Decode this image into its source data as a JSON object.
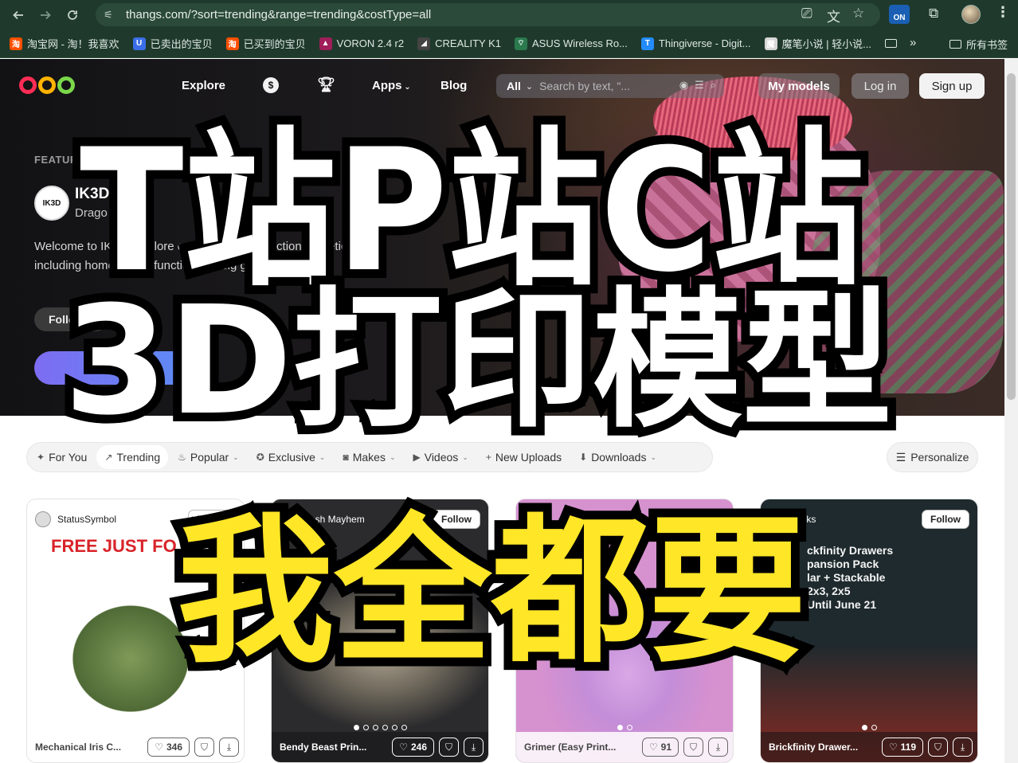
{
  "browser": {
    "url": "thangs.com/?sort=trending&range=trending&costType=all",
    "extension_badge": "ON",
    "bookmarks": [
      {
        "label": "淘宝网 - 淘！我喜欢",
        "icon": "taobao-icon",
        "color": "#ff5000",
        "glyph": "淘"
      },
      {
        "label": "已卖出的宝贝",
        "icon": "shield-icon",
        "color": "#3b6ee8",
        "glyph": "U"
      },
      {
        "label": "已买到的宝贝",
        "icon": "taobao-icon",
        "color": "#ff5000",
        "glyph": "淘"
      },
      {
        "label": "VORON 2.4 r2",
        "icon": "voron-icon",
        "color": "#a01e5a",
        "glyph": "▲"
      },
      {
        "label": "CREALITY K1",
        "icon": "creality-icon",
        "color": "#444444",
        "glyph": "◢"
      },
      {
        "label": "ASUS Wireless Ro...",
        "icon": "wifi-icon",
        "color": "#2a7a4e",
        "glyph": "⌔"
      },
      {
        "label": "Thingiverse - Digit...",
        "icon": "thingiverse-icon",
        "color": "#248bfb",
        "glyph": "T"
      },
      {
        "label": "魔笔小说 | 轻小说...",
        "icon": "book-icon",
        "color": "#d8d8d8",
        "glyph": "魔"
      }
    ],
    "all_bookmarks_label": "所有书签"
  },
  "site": {
    "brand_colors": [
      "#ff2d55",
      "#ffb300",
      "#7ad84a"
    ],
    "nav": {
      "explore": "Explore",
      "apps": "Apps",
      "blog": "Blog"
    },
    "search": {
      "scope": "All",
      "placeholder": "Search by text, \"..."
    },
    "buttons": {
      "my_models": "My models",
      "login": "Log in",
      "signup": "Sign up"
    }
  },
  "hero": {
    "featured_label": "FEATURED DE      ER",
    "designer_name": "IK3D",
    "designer_sub": "Drago       n bowl",
    "avatar_text": "IK3D",
    "description": "Welcome to IK3D! Explore our extensive collection of metic         3D          including home decor, functional desig     g",
    "follow_label": "Follo"
  },
  "filters": [
    {
      "label": "For You",
      "icon": "sparkle-icon",
      "glyph": "✦",
      "chevron": false,
      "active": false
    },
    {
      "label": "Trending",
      "icon": "trending-icon",
      "glyph": "↗",
      "chevron": false,
      "active": true
    },
    {
      "label": "Popular",
      "icon": "fire-icon",
      "glyph": "♨",
      "chevron": true,
      "active": false
    },
    {
      "label": "Exclusive",
      "icon": "badge-icon",
      "glyph": "✪",
      "chevron": true,
      "active": false
    },
    {
      "label": "Makes",
      "icon": "camera-icon",
      "glyph": "◙",
      "chevron": true,
      "active": false
    },
    {
      "label": "Videos",
      "icon": "video-icon",
      "glyph": "▶",
      "chevron": true,
      "active": false
    },
    {
      "label": "New Uploads",
      "icon": "plus-icon",
      "glyph": "+",
      "chevron": false,
      "active": false
    },
    {
      "label": "Downloads",
      "icon": "download-circle-icon",
      "glyph": "⬇",
      "chevron": true,
      "active": false
    }
  ],
  "personalize_label": "Personalize",
  "cards": [
    {
      "author": "StatusSymbol",
      "follow": "Follow",
      "title": "Mechanical Iris C...",
      "likes": "346",
      "promo": "FREE JUST FO",
      "dots": 4,
      "dark": false
    },
    {
      "author": "Mesh Mayhem",
      "follow": "Follow",
      "title": "Bendy Beast Prin...",
      "likes": "246",
      "promo": "",
      "dots": 6,
      "dark": true
    },
    {
      "author": "",
      "follow": "",
      "title": "Grimer (Easy Print...",
      "likes": "91",
      "promo": "",
      "dots": 2,
      "dark": false
    },
    {
      "author": "Mieks",
      "follow": "Follow",
      "title": "Brickfinity Drawer...",
      "likes": "119",
      "promo": "ckfinity Drawers\npansion Pack\nlar + Stackable\n2x3, 2x5\nUntil June 21",
      "dots": 2,
      "dark": true
    }
  ],
  "overlay": {
    "line1": "T站P站C站",
    "line2": "3D打印模型",
    "line3": "我全都要"
  }
}
